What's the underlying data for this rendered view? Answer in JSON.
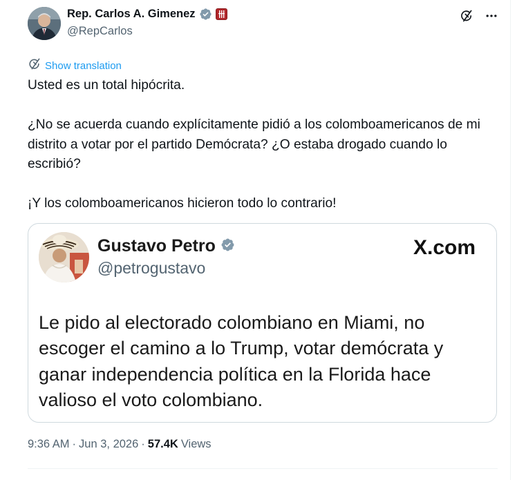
{
  "author": {
    "name": "Rep. Carlos A. Gimenez",
    "handle": "@RepCarlos",
    "verified_color": "#829aab",
    "affiliation_badge_color": "#b1262a"
  },
  "actions": {
    "grok_icon": "grok-icon",
    "more_icon": "more-icon"
  },
  "translation": {
    "label": "Show translation",
    "color": "#1d9bf0"
  },
  "tweet": {
    "paragraphs": [
      "Usted es un total hipócrita.",
      "¿No se acuerda cuando explícitamente pidió a los colomboamericanos de mi distrito a votar por el partido Demócrata? ¿O estaba drogado cuando lo escribió?",
      "¡Y los colomboamericanos hicieron todo lo contrario!"
    ]
  },
  "quoted": {
    "name": "Gustavo Petro",
    "handle": "@petrogustavo",
    "brand": "X.com",
    "text": "Le pido al electorado colombiano en Miami, no escoger el camino a lo Trump, votar demócrata y ganar independencia política en la Florida hace valioso el voto colombiano."
  },
  "meta": {
    "time": "9:36 AM",
    "separator": "·",
    "date": "Jun 3, 2026",
    "separator2": "·",
    "views_count": "57.4K",
    "views_label": "Views"
  }
}
